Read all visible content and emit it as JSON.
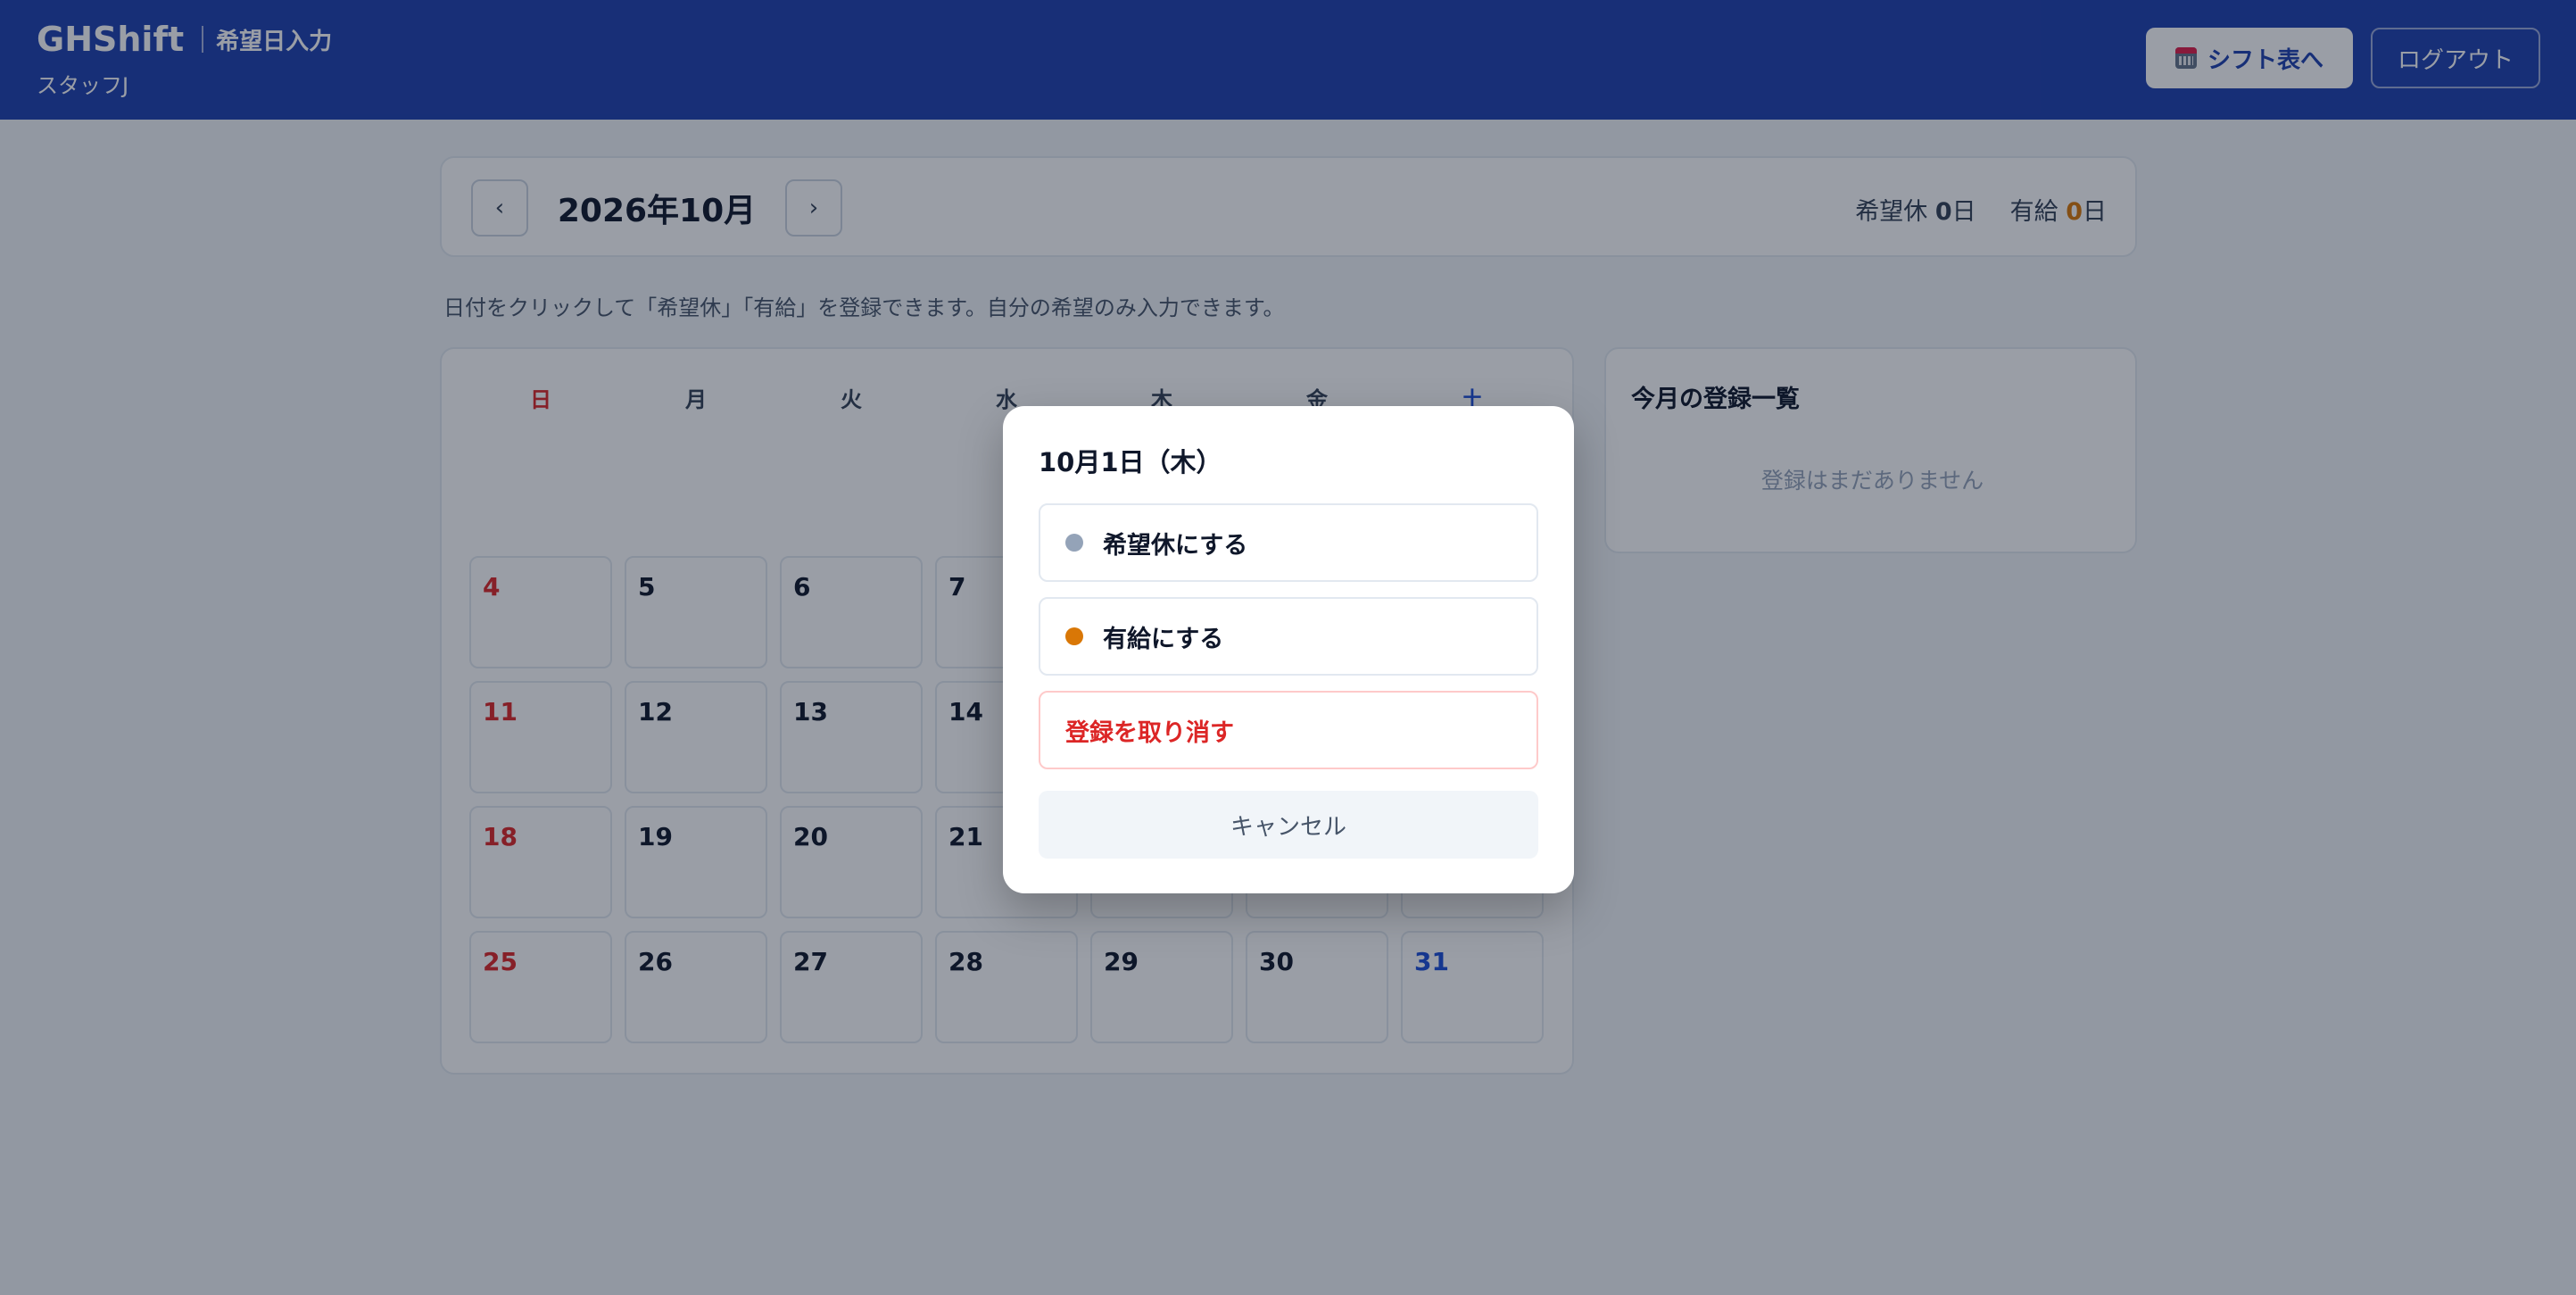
{
  "header": {
    "app_name": "GHShift",
    "page_name": "希望日入力",
    "staff_name": "スタッフJ",
    "shift_button_label": "シフト表へ",
    "shift_button_icon": "calendar-icon",
    "logout_label": "ログアウト"
  },
  "month_nav": {
    "prev_label": "‹",
    "next_label": "›",
    "title": "2026年10月",
    "holiday_label": "希望休",
    "holiday_count": "0",
    "paid_label": "有給",
    "paid_count": "0",
    "day_unit": "日"
  },
  "help_text": "日付をクリックして「希望休」「有給」を登録できます。自分の希望のみ入力できます。",
  "calendar": {
    "weekdays": [
      "日",
      "月",
      "火",
      "水",
      "木",
      "金",
      "土"
    ],
    "first_weekday_index": 4,
    "days_in_month": 31
  },
  "side_panel": {
    "title": "今月の登録一覧",
    "empty_text": "登録はまだありません"
  },
  "modal": {
    "title": "10月1日（木）",
    "options": [
      {
        "label": "希望休にする",
        "dot_color": "#94a3b8"
      },
      {
        "label": "有給にする",
        "dot_color": "#d97706"
      }
    ],
    "remove_label": "登録を取り消す",
    "cancel_label": "キャンセル"
  },
  "colors": {
    "header_bg": "#1e40af",
    "sunday": "#dc2626",
    "saturday": "#1d4ed8",
    "paid": "#d97706",
    "holiday": "#94a3b8"
  }
}
